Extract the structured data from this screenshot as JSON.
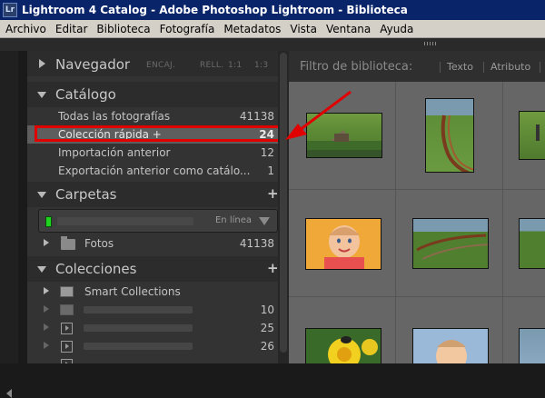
{
  "window": {
    "app_icon": "Lr",
    "title": "Lightroom 4 Catalog - Adobe Photoshop Lightroom - Biblioteca"
  },
  "menu": [
    "Archivo",
    "Editar",
    "Biblioteca",
    "Fotografía",
    "Metadatos",
    "Vista",
    "Ventana",
    "Ayuda"
  ],
  "navigator": {
    "title": "Navegador",
    "options": [
      "ENCAJ.",
      "RELL.",
      "1:1",
      "1:3"
    ]
  },
  "catalog": {
    "title": "Catálogo",
    "rows": [
      {
        "label": "Todas las fotografías",
        "count": "41138"
      },
      {
        "label": "Colección rápida  +",
        "count": "24"
      },
      {
        "label": "Importación anterior",
        "count": "12"
      },
      {
        "label": "Exportación anterior como catálo...",
        "count": "1"
      }
    ]
  },
  "folders": {
    "title": "Carpetas",
    "add_label": "+",
    "drive_status": "En línea",
    "folder_name": "Fotos",
    "folder_count": "41138"
  },
  "collections": {
    "title": "Colecciones",
    "add_label": "+",
    "smart": "Smart Collections",
    "counts": [
      "10",
      "25",
      "26"
    ]
  },
  "library_filter": {
    "title": "Filtro de biblioteca:",
    "options": [
      "Texto",
      "Atributo"
    ]
  },
  "colors": {
    "titlebar": "#0a246a",
    "panel": "#333333",
    "highlight": "#e00000",
    "grid": "#777777"
  }
}
